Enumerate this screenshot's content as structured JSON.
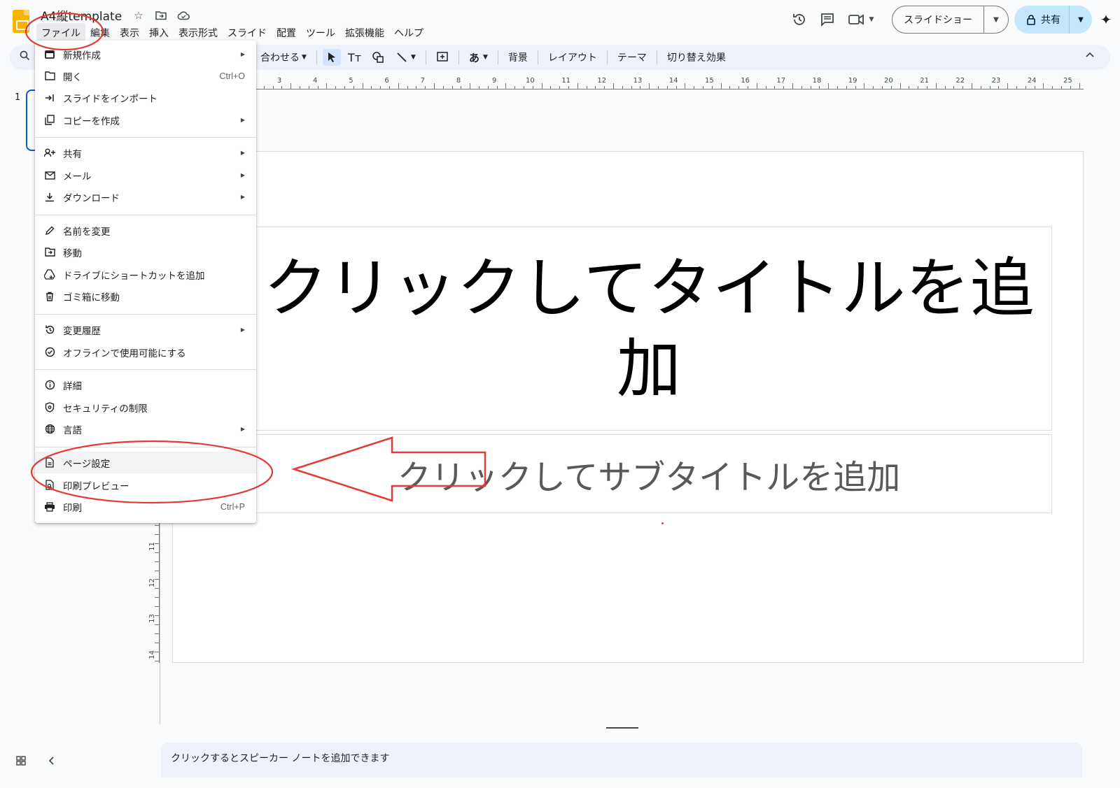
{
  "app": {
    "document_title": "A4縦template",
    "menubar": [
      "ファイル",
      "編集",
      "表示",
      "挿入",
      "表示形式",
      "スライド",
      "配置",
      "ツール",
      "拡張機能",
      "ヘルプ"
    ],
    "slideshow_label": "スライドショー",
    "share_label": "共有"
  },
  "toolbar": {
    "fit_label": "合わせる",
    "input_label": "あ",
    "text_label": "Tт",
    "background_label": "背景",
    "layout_label": "レイアウト",
    "theme_label": "テーマ",
    "transition_label": "切り替え効果"
  },
  "filmstrip": {
    "slide_number": "1"
  },
  "ruler": {
    "top_numbers": [
      "3",
      "4",
      "5",
      "6",
      "7",
      "8",
      "9",
      "10",
      "11",
      "12",
      "13",
      "14",
      "15",
      "16",
      "17",
      "18",
      "19",
      "20",
      "21",
      "22",
      "23",
      "24",
      "25"
    ],
    "left_numbers": [
      "11",
      "12",
      "13",
      "14"
    ]
  },
  "slide": {
    "title_placeholder": "クリックしてタイトルを追加",
    "subtitle_placeholder": "クリックしてサブタイトルを追加"
  },
  "notes": {
    "placeholder": "クリックするとスピーカー ノートを追加できます"
  },
  "file_menu": {
    "items": [
      {
        "label": "新規作成",
        "icon": "new-slides-icon",
        "submenu": true
      },
      {
        "label": "開く",
        "icon": "folder-open-icon",
        "shortcut": "Ctrl+O"
      },
      {
        "label": "スライドをインポート",
        "icon": "import-icon"
      },
      {
        "label": "コピーを作成",
        "icon": "copy-icon",
        "submenu": true
      },
      {
        "label": "共有",
        "icon": "person-add-icon",
        "submenu": true
      },
      {
        "label": "メール",
        "icon": "mail-icon",
        "submenu": true
      },
      {
        "label": "ダウンロード",
        "icon": "download-icon",
        "submenu": true
      },
      {
        "label": "名前を変更",
        "icon": "pencil-icon"
      },
      {
        "label": "移動",
        "icon": "move-folder-icon"
      },
      {
        "label": "ドライブにショートカットを追加",
        "icon": "drive-shortcut-icon"
      },
      {
        "label": "ゴミ箱に移動",
        "icon": "trash-icon"
      },
      {
        "label": "変更履歴",
        "icon": "history-icon",
        "submenu": true
      },
      {
        "label": "オフラインで使用可能にする",
        "icon": "offline-icon"
      },
      {
        "label": "詳細",
        "icon": "info-icon"
      },
      {
        "label": "セキュリティの制限",
        "icon": "security-icon"
      },
      {
        "label": "言語",
        "icon": "globe-icon",
        "submenu": true
      },
      {
        "label": "ページ設定",
        "icon": "page-setup-icon",
        "highlighted": true
      },
      {
        "label": "印刷プレビュー",
        "icon": "print-preview-icon"
      },
      {
        "label": "印刷",
        "icon": "printer-icon",
        "shortcut": "Ctrl+P"
      }
    ]
  },
  "colors": {
    "accent_blue": "#0b57d0",
    "share_button": "#c2e7ff",
    "annotation_red": "#e53935",
    "logo_yellow": "#f4b400"
  }
}
